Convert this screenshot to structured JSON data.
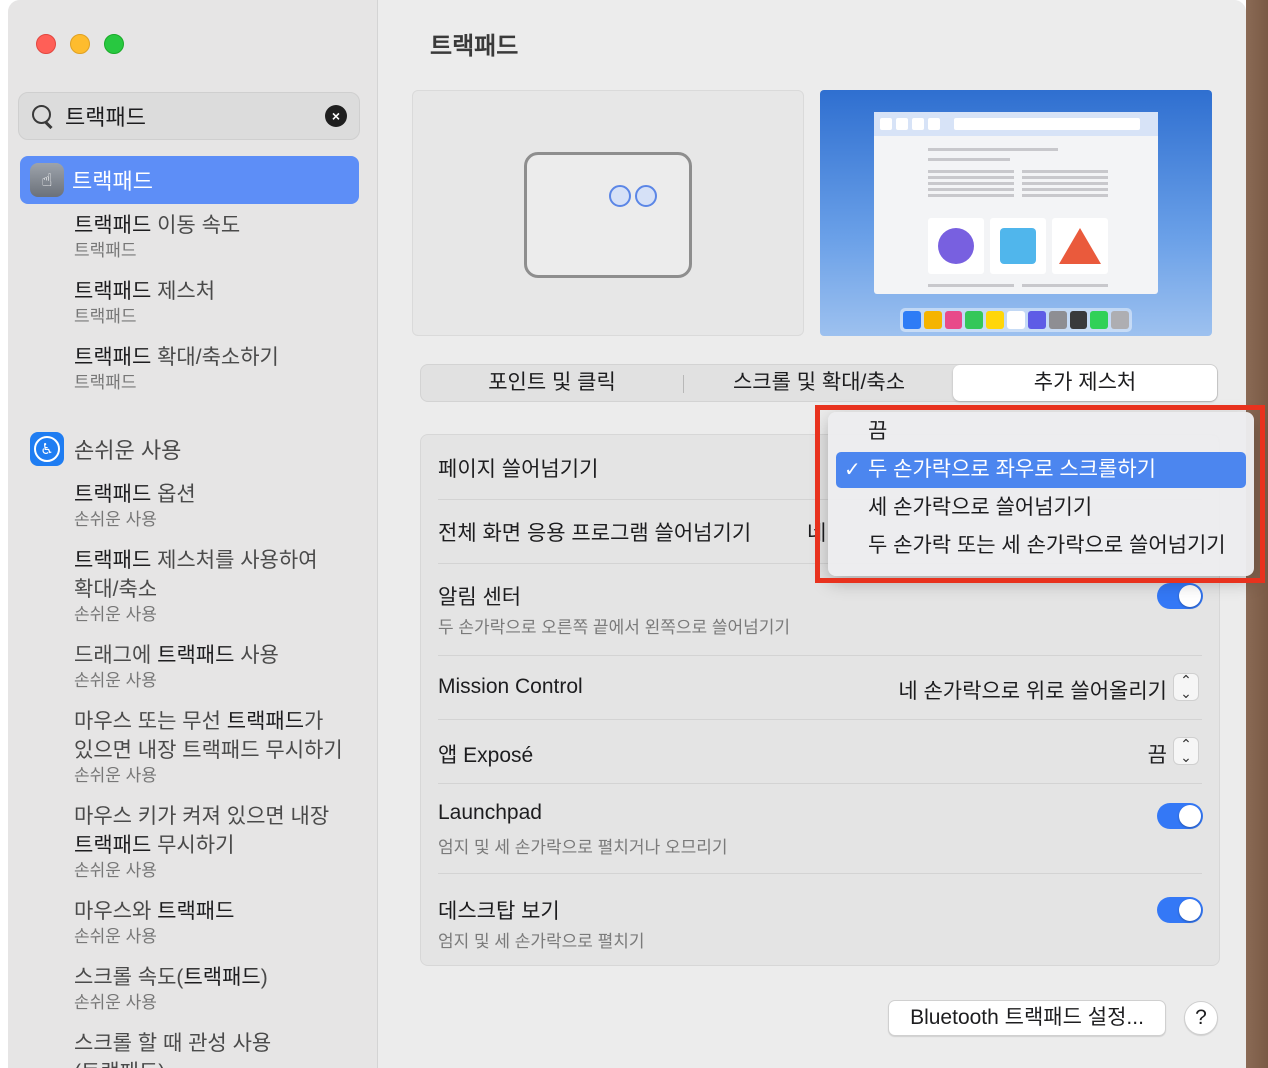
{
  "window": {
    "title": "트랙패드"
  },
  "sidebar": {
    "search": {
      "value": "트랙패드",
      "clear_icon": "xmark-circle-icon"
    },
    "selected": {
      "label": "트랙패드",
      "icon": "trackpad-icon"
    },
    "items": [
      {
        "title_prefix": "트랙패드",
        "title_rest": " 이동 속도",
        "subtitle": "트랙패드"
      },
      {
        "title_prefix": "트랙패드",
        "title_rest": " 제스처",
        "subtitle": "트랙패드"
      },
      {
        "title_prefix": "트랙패드",
        "title_rest": " 확대/축소하기",
        "subtitle": "트랙패드"
      }
    ],
    "accessibility": {
      "label": "손쉬운 사용",
      "icon": "accessibility-icon"
    },
    "acc_items": [
      {
        "line1_b": "트랙패드",
        "line1": " 옵션",
        "line2": "",
        "subtitle": "손쉬운 사용"
      },
      {
        "line1_b": "트랙패드",
        "line1": " 제스처를 사용하여",
        "line2": "확대/축소",
        "subtitle": "손쉬운 사용"
      },
      {
        "line1_pre": "드래그에 ",
        "line1_b": "트랙패드",
        "line1": " 사용",
        "line2": "",
        "subtitle": "손쉬운 사용"
      },
      {
        "line1_pre": "마우스 또는 무선 ",
        "line1_b": "트랙패드",
        "line1": "가",
        "line2": "있으면 내장 트랙패드 무시하기",
        "subtitle": "손쉬운 사용"
      },
      {
        "line1_pre": "마우스 키가 켜져 있으면 내장",
        "line1_b": "",
        "line1": "",
        "line2_b": "트랙패드",
        "line2": " 무시하기",
        "subtitle": "손쉬운 사용"
      },
      {
        "line1_pre": "마우스와 ",
        "line1_b": "트랙패드",
        "line1": "",
        "line2": "",
        "subtitle": "손쉬운 사용"
      },
      {
        "line1_pre": "스크롤 속도(",
        "line1_b": "트랙패드",
        "line1": ")",
        "line2": "",
        "subtitle": "손쉬운 사용"
      },
      {
        "line1_pre": "스크롤 할 때 관성 사용",
        "line1_b": "",
        "line1": "",
        "line2": "(트랙패드)",
        "subtitle": ""
      }
    ]
  },
  "main": {
    "title": "트랙패드",
    "tabs": [
      {
        "label": "포인트 및 클릭"
      },
      {
        "label": "스크롤 및 확대/축소"
      },
      {
        "label": "추가 제스처",
        "active": true
      }
    ],
    "rows": [
      {
        "label": "페이지 쓸어넘기기",
        "value": ""
      },
      {
        "label": "전체 화면 응용 프로그램 쓸어넘기기",
        "value": "네"
      },
      {
        "label": "알림 센터",
        "sub": "두 손가락으로 오른쪽 끝에서 왼쪽으로 쓸어넘기기",
        "toggle": true
      },
      {
        "label": "Mission Control",
        "value": "네 손가락으로 위로 쓸어올리기"
      },
      {
        "label": "앱 Exposé",
        "value": "끔"
      },
      {
        "label": "Launchpad",
        "sub": "엄지 및 세 손가락으로 펼치거나 오므리기",
        "toggle": true
      },
      {
        "label": "데스크탑 보기",
        "sub": "엄지 및 세 손가락으로 펼치기",
        "toggle": true
      }
    ],
    "bluetooth_button": "Bluetooth 트랙패드 설정...",
    "help_button": "?"
  },
  "dropdown": {
    "options": [
      {
        "label": "끔",
        "selected": false
      },
      {
        "label": "두 손가락으로 좌우로 스크롤하기",
        "selected": true
      },
      {
        "label": "세 손가락으로 쓸어넘기기",
        "selected": false
      },
      {
        "label": "두 손가락 또는 세 손가락으로 쓸어넘기기",
        "selected": false
      }
    ],
    "check_mark": "✓"
  },
  "colors": {
    "accent": "#3478f6",
    "sidebar_selected": "#5d8ef7",
    "highlight_box": "#e8321e"
  }
}
